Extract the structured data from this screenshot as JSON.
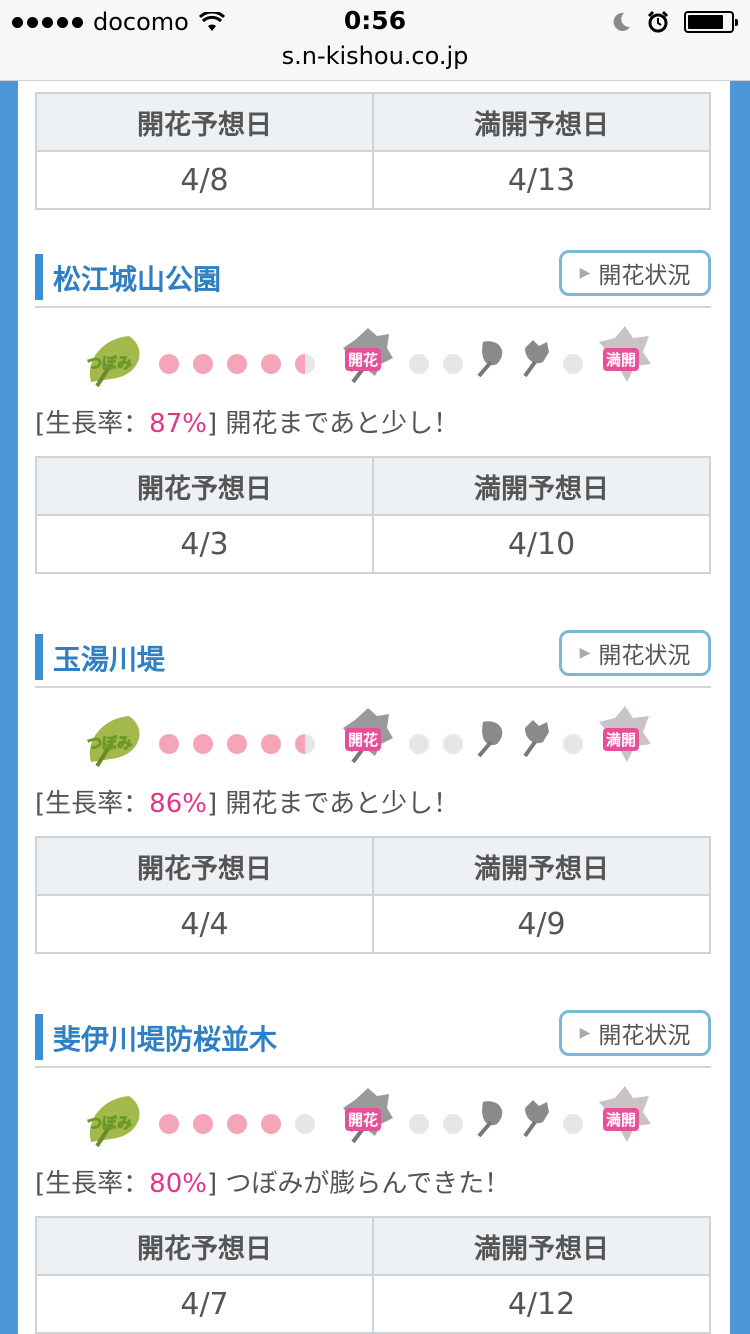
{
  "status_bar": {
    "carrier": "docomo",
    "time": "0:56",
    "url": "s.n-kishou.co.jp"
  },
  "labels": {
    "bloom_date": "開花予想日",
    "full_bloom_date": "満開予想日",
    "status_button": "開花状況",
    "bud": "つぼみ",
    "bloom": "開花",
    "full": "満開",
    "rate_prefix": "[生長率：",
    "rate_suffix": "]"
  },
  "top_table": {
    "bloom": "4/8",
    "full": "4/13"
  },
  "sites": [
    {
      "name": "松江城山公園",
      "rate": "87%",
      "message": "開花まであと少し！",
      "progress": [
        "pink",
        "pink",
        "pink",
        "pink",
        "half"
      ],
      "bloom": "4/3",
      "full": "4/10"
    },
    {
      "name": "玉湯川堤",
      "rate": "86%",
      "message": "開花まであと少し！",
      "progress": [
        "pink",
        "pink",
        "pink",
        "pink",
        "half"
      ],
      "bloom": "4/4",
      "full": "4/9"
    },
    {
      "name": "斐伊川堤防桜並木",
      "rate": "80%",
      "message": "つぼみが膨らんできた！",
      "progress": [
        "pink",
        "pink",
        "pink",
        "pink",
        "grey"
      ],
      "bloom": "4/7",
      "full": "4/12"
    }
  ]
}
